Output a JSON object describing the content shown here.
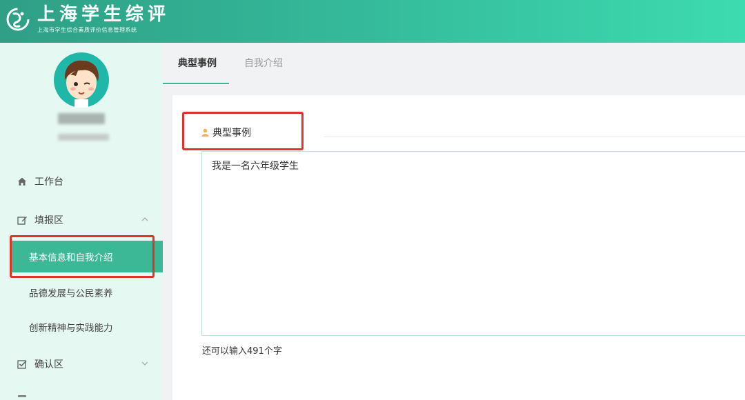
{
  "header": {
    "title": "上海学生综评",
    "subtitle": "上海市学生综合素质评价信息管理系统",
    "logo_icon": "swirl-logo-icon"
  },
  "user": {
    "avatar_icon": "cartoon-boy-avatar-icon"
  },
  "sidebar": {
    "items": [
      {
        "label": "工作台",
        "icon": "home-icon"
      },
      {
        "label": "填报区",
        "icon": "edit-icon",
        "expanded": true
      },
      {
        "label": "基本信息和自我介绍",
        "active": true
      },
      {
        "label": "品德发展与公民素养"
      },
      {
        "label": "创新精神与实践能力"
      },
      {
        "label": "确认区",
        "icon": "check-square-icon",
        "expanded": false
      }
    ]
  },
  "main": {
    "tabs": [
      {
        "label": "典型事例",
        "active": true
      },
      {
        "label": "自我介绍",
        "active": false
      }
    ],
    "section": {
      "label": "典型事例",
      "icon": "user-icon"
    },
    "textarea": {
      "value": "我是一名六年级学生"
    },
    "counter": "还可以输入491个字"
  },
  "colors": {
    "accent": "#3db897",
    "header_start": "#2f9f86",
    "header_end": "#3ddbb0",
    "sidebar_bg": "#e6f8f2",
    "highlight_box": "#e0322a"
  }
}
